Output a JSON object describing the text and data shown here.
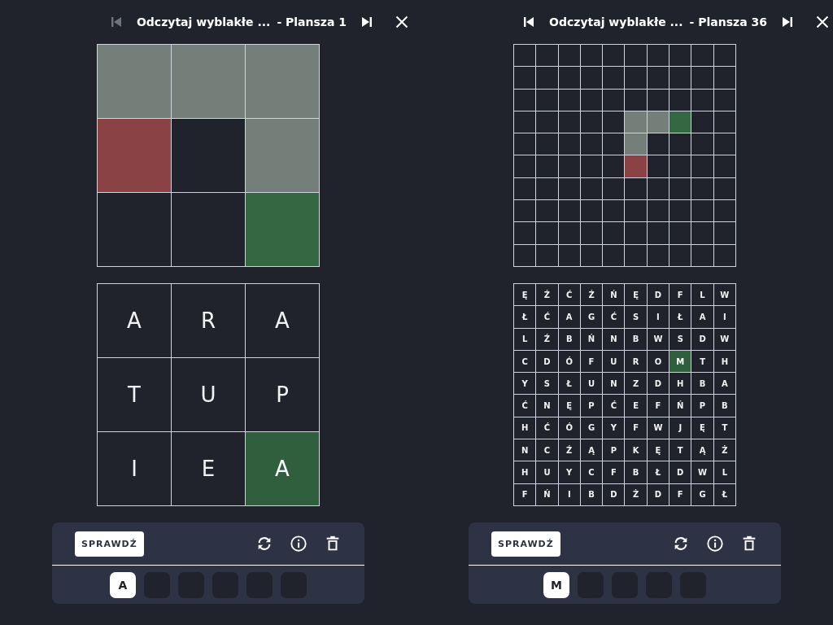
{
  "panels": [
    {
      "header": {
        "title": "Odczytaj wyblakłe ...",
        "board": "- Plansza 1",
        "prev_disabled": true
      },
      "color_grid": {
        "rows": [
          [
            {
              "filled": true,
              "color": "#757f7a"
            },
            {
              "filled": true,
              "color": "#757f7a"
            },
            {
              "filled": true,
              "color": "#757f7a"
            }
          ],
          [
            {
              "filled": true,
              "color": "#8b4244"
            },
            {
              "filled": false
            },
            {
              "filled": true,
              "color": "#757f7a"
            }
          ],
          [
            {
              "filled": false
            },
            {
              "filled": false
            },
            {
              "filled": true,
              "color": "#346843"
            }
          ]
        ]
      },
      "letter_grid": {
        "rows": [
          [
            {
              "letter": "A",
              "selected": false
            },
            {
              "letter": "R",
              "selected": false
            },
            {
              "letter": "A",
              "selected": false
            }
          ],
          [
            {
              "letter": "T",
              "selected": false
            },
            {
              "letter": "U",
              "selected": false
            },
            {
              "letter": "P",
              "selected": false
            }
          ],
          [
            {
              "letter": "I",
              "selected": false
            },
            {
              "letter": "E",
              "selected": false
            },
            {
              "letter": "A",
              "selected": true
            }
          ]
        ]
      },
      "check_button": "SPRAWDŹ",
      "slots": [
        {
          "kind": "letter",
          "letter": "A"
        },
        {
          "kind": "empty"
        },
        {
          "kind": "empty"
        },
        {
          "kind": "empty"
        },
        {
          "kind": "empty"
        },
        {
          "kind": "empty"
        }
      ]
    },
    {
      "header": {
        "title": "Odczytaj wyblakłe ...",
        "board": "- Plansza 36",
        "prev_disabled": false
      },
      "color_grid": {
        "rows": [
          [
            {
              "filled": false
            },
            {
              "filled": false
            },
            {
              "filled": false
            },
            {
              "filled": false
            },
            {
              "filled": false
            },
            {
              "filled": false
            },
            {
              "filled": false
            },
            {
              "filled": false
            },
            {
              "filled": false
            },
            {
              "filled": false
            }
          ],
          [
            {
              "filled": false
            },
            {
              "filled": false
            },
            {
              "filled": false
            },
            {
              "filled": false
            },
            {
              "filled": false
            },
            {
              "filled": false
            },
            {
              "filled": false
            },
            {
              "filled": false
            },
            {
              "filled": false
            },
            {
              "filled": false
            }
          ],
          [
            {
              "filled": false
            },
            {
              "filled": false
            },
            {
              "filled": false
            },
            {
              "filled": false
            },
            {
              "filled": false
            },
            {
              "filled": false
            },
            {
              "filled": false
            },
            {
              "filled": false
            },
            {
              "filled": false
            },
            {
              "filled": false
            }
          ],
          [
            {
              "filled": false
            },
            {
              "filled": false
            },
            {
              "filled": false
            },
            {
              "filled": false
            },
            {
              "filled": false
            },
            {
              "filled": true,
              "color": "#757f7a"
            },
            {
              "filled": true,
              "color": "#757f7a"
            },
            {
              "filled": true,
              "color": "#346843"
            },
            {
              "filled": false
            },
            {
              "filled": false
            }
          ],
          [
            {
              "filled": false
            },
            {
              "filled": false
            },
            {
              "filled": false
            },
            {
              "filled": false
            },
            {
              "filled": false
            },
            {
              "filled": true,
              "color": "#757f7a"
            },
            {
              "filled": false
            },
            {
              "filled": false
            },
            {
              "filled": false
            },
            {
              "filled": false
            }
          ],
          [
            {
              "filled": false
            },
            {
              "filled": false
            },
            {
              "filled": false
            },
            {
              "filled": false
            },
            {
              "filled": false
            },
            {
              "filled": true,
              "color": "#8b4244"
            },
            {
              "filled": false
            },
            {
              "filled": false
            },
            {
              "filled": false
            },
            {
              "filled": false
            }
          ],
          [
            {
              "filled": false
            },
            {
              "filled": false
            },
            {
              "filled": false
            },
            {
              "filled": false
            },
            {
              "filled": false
            },
            {
              "filled": false
            },
            {
              "filled": false
            },
            {
              "filled": false
            },
            {
              "filled": false
            },
            {
              "filled": false
            }
          ],
          [
            {
              "filled": false
            },
            {
              "filled": false
            },
            {
              "filled": false
            },
            {
              "filled": false
            },
            {
              "filled": false
            },
            {
              "filled": false
            },
            {
              "filled": false
            },
            {
              "filled": false
            },
            {
              "filled": false
            },
            {
              "filled": false
            }
          ],
          [
            {
              "filled": false
            },
            {
              "filled": false
            },
            {
              "filled": false
            },
            {
              "filled": false
            },
            {
              "filled": false
            },
            {
              "filled": false
            },
            {
              "filled": false
            },
            {
              "filled": false
            },
            {
              "filled": false
            },
            {
              "filled": false
            }
          ],
          [
            {
              "filled": false
            },
            {
              "filled": false
            },
            {
              "filled": false
            },
            {
              "filled": false
            },
            {
              "filled": false
            },
            {
              "filled": false
            },
            {
              "filled": false
            },
            {
              "filled": false
            },
            {
              "filled": false
            },
            {
              "filled": false
            }
          ]
        ]
      },
      "letter_grid": {
        "rows": [
          [
            {
              "letter": "Ę",
              "selected": false
            },
            {
              "letter": "Ź",
              "selected": false
            },
            {
              "letter": "Ć",
              "selected": false
            },
            {
              "letter": "Ź",
              "selected": false
            },
            {
              "letter": "Ń",
              "selected": false
            },
            {
              "letter": "Ę",
              "selected": false
            },
            {
              "letter": "D",
              "selected": false
            },
            {
              "letter": "F",
              "selected": false
            },
            {
              "letter": "L",
              "selected": false
            },
            {
              "letter": "W",
              "selected": false
            }
          ],
          [
            {
              "letter": "Ł",
              "selected": false
            },
            {
              "letter": "Ć",
              "selected": false
            },
            {
              "letter": "A",
              "selected": false
            },
            {
              "letter": "G",
              "selected": false
            },
            {
              "letter": "Ć",
              "selected": false
            },
            {
              "letter": "S",
              "selected": false
            },
            {
              "letter": "I",
              "selected": false
            },
            {
              "letter": "Ł",
              "selected": false
            },
            {
              "letter": "A",
              "selected": false
            },
            {
              "letter": "I",
              "selected": false
            }
          ],
          [
            {
              "letter": "L",
              "selected": false
            },
            {
              "letter": "Ź",
              "selected": false
            },
            {
              "letter": "B",
              "selected": false
            },
            {
              "letter": "Ń",
              "selected": false
            },
            {
              "letter": "N",
              "selected": false
            },
            {
              "letter": "B",
              "selected": false
            },
            {
              "letter": "W",
              "selected": false
            },
            {
              "letter": "S",
              "selected": false
            },
            {
              "letter": "D",
              "selected": false
            },
            {
              "letter": "W",
              "selected": false
            }
          ],
          [
            {
              "letter": "C",
              "selected": false
            },
            {
              "letter": "D",
              "selected": false
            },
            {
              "letter": "Ó",
              "selected": false
            },
            {
              "letter": "F",
              "selected": false
            },
            {
              "letter": "U",
              "selected": false
            },
            {
              "letter": "R",
              "selected": false
            },
            {
              "letter": "O",
              "selected": false
            },
            {
              "letter": "M",
              "selected": true
            },
            {
              "letter": "T",
              "selected": false
            },
            {
              "letter": "H",
              "selected": false
            }
          ],
          [
            {
              "letter": "Y",
              "selected": false
            },
            {
              "letter": "S",
              "selected": false
            },
            {
              "letter": "Ł",
              "selected": false
            },
            {
              "letter": "U",
              "selected": false
            },
            {
              "letter": "N",
              "selected": false
            },
            {
              "letter": "Z",
              "selected": false
            },
            {
              "letter": "D",
              "selected": false
            },
            {
              "letter": "H",
              "selected": false
            },
            {
              "letter": "B",
              "selected": false
            },
            {
              "letter": "A",
              "selected": false
            }
          ],
          [
            {
              "letter": "Ć",
              "selected": false
            },
            {
              "letter": "N",
              "selected": false
            },
            {
              "letter": "Ę",
              "selected": false
            },
            {
              "letter": "P",
              "selected": false
            },
            {
              "letter": "Ć",
              "selected": false
            },
            {
              "letter": "E",
              "selected": false
            },
            {
              "letter": "F",
              "selected": false
            },
            {
              "letter": "Ń",
              "selected": false
            },
            {
              "letter": "P",
              "selected": false
            },
            {
              "letter": "B",
              "selected": false
            }
          ],
          [
            {
              "letter": "H",
              "selected": false
            },
            {
              "letter": "Ć",
              "selected": false
            },
            {
              "letter": "Ó",
              "selected": false
            },
            {
              "letter": "G",
              "selected": false
            },
            {
              "letter": "Y",
              "selected": false
            },
            {
              "letter": "F",
              "selected": false
            },
            {
              "letter": "W",
              "selected": false
            },
            {
              "letter": "J",
              "selected": false
            },
            {
              "letter": "Ę",
              "selected": false
            },
            {
              "letter": "T",
              "selected": false
            }
          ],
          [
            {
              "letter": "N",
              "selected": false
            },
            {
              "letter": "C",
              "selected": false
            },
            {
              "letter": "Ź",
              "selected": false
            },
            {
              "letter": "Ą",
              "selected": false
            },
            {
              "letter": "P",
              "selected": false
            },
            {
              "letter": "K",
              "selected": false
            },
            {
              "letter": "Ę",
              "selected": false
            },
            {
              "letter": "T",
              "selected": false
            },
            {
              "letter": "Ą",
              "selected": false
            },
            {
              "letter": "Ż",
              "selected": false
            }
          ],
          [
            {
              "letter": "H",
              "selected": false
            },
            {
              "letter": "U",
              "selected": false
            },
            {
              "letter": "Y",
              "selected": false
            },
            {
              "letter": "C",
              "selected": false
            },
            {
              "letter": "F",
              "selected": false
            },
            {
              "letter": "B",
              "selected": false
            },
            {
              "letter": "Ł",
              "selected": false
            },
            {
              "letter": "D",
              "selected": false
            },
            {
              "letter": "W",
              "selected": false
            },
            {
              "letter": "L",
              "selected": false
            }
          ],
          [
            {
              "letter": "F",
              "selected": false
            },
            {
              "letter": "Ń",
              "selected": false
            },
            {
              "letter": "I",
              "selected": false
            },
            {
              "letter": "B",
              "selected": false
            },
            {
              "letter": "D",
              "selected": false
            },
            {
              "letter": "Ż",
              "selected": false
            },
            {
              "letter": "D",
              "selected": false
            },
            {
              "letter": "F",
              "selected": false
            },
            {
              "letter": "G",
              "selected": false
            },
            {
              "letter": "Ł",
              "selected": false
            }
          ]
        ]
      },
      "check_button": "SPRAWDŹ",
      "slots": [
        {
          "kind": "letter",
          "letter": "M"
        },
        {
          "kind": "empty"
        },
        {
          "kind": "empty"
        },
        {
          "kind": "empty"
        },
        {
          "kind": "empty"
        }
      ]
    }
  ]
}
